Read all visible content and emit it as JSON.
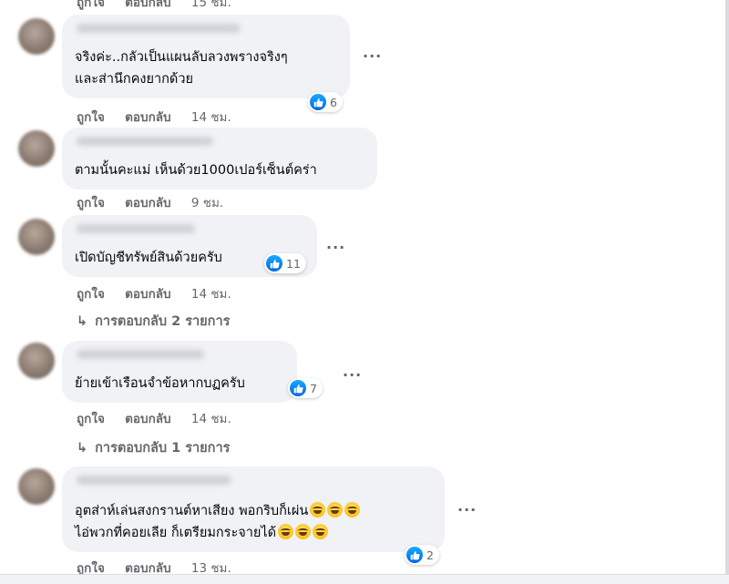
{
  "top_partial": {
    "like": "ถูกใจ",
    "reply": "ตอบกลับ",
    "time": "15 ชม."
  },
  "comments": [
    {
      "lines": [
        "จริงค่ะ..กลัวเป็นแผนลับลวงพรางจริงๆ",
        "และส่านึกคงยากด้วย"
      ],
      "reaction_count": "6",
      "like": "ถูกใจ",
      "reply": "ตอบกลับ",
      "time": "14 ชม."
    },
    {
      "lines": [
        "ตามนั้นคะแม่ เห็นด้วย1000เปอร์เซ็นต์คร่า"
      ],
      "like": "ถูกใจ",
      "reply": "ตอบกลับ",
      "time": "9 ชม."
    },
    {
      "lines": [
        "เปิดบัญชีทรัพย์สินด้วยครับ"
      ],
      "reaction_count": "11",
      "like": "ถูกใจ",
      "reply": "ตอบกลับ",
      "time": "14 ชม.",
      "replies": "การตอบกลับ 2 รายการ"
    },
    {
      "lines": [
        "ย้ายเข้าเรือนจำข้อหากบฏครับ"
      ],
      "reaction_count": "7",
      "like": "ถูกใจ",
      "reply": "ตอบกลับ",
      "time": "14 ชม.",
      "replies": "การตอบกลับ 1 รายการ"
    },
    {
      "lines": [
        "อุตส่าห์เล่นสงกรานต์หาเสียง พอกริบก็เผ่น",
        "ไอ่พวกที่คอยเลีย ก็เตรียมกระจายได้"
      ],
      "reaction_count": "2",
      "like": "ถูกใจ",
      "reply": "ตอบกลับ",
      "time": "13 ชม."
    }
  ],
  "icons": {
    "like": "thumbs-up-icon",
    "more": "more-options-icon",
    "reply_arrow": "reply-arrow-icon",
    "emoji": "grinning-squinting-face-emoji"
  },
  "colors": {
    "bubble": "#f0f2f5",
    "secondary_text": "#65676b",
    "like_blue": "#0866ff"
  }
}
